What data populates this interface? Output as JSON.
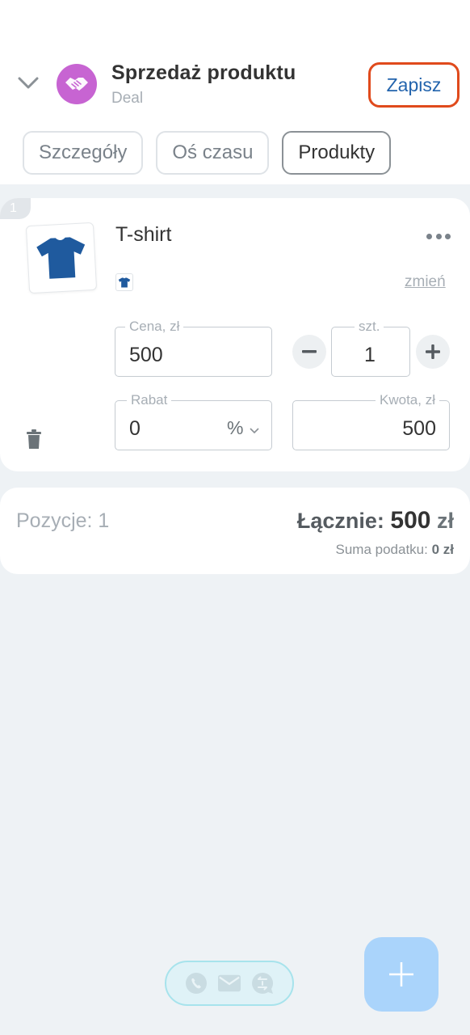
{
  "header": {
    "title": "Sprzedaż produktu",
    "subtitle": "Deal",
    "save_label": "Zapisz",
    "avatar_color": "#c764d2",
    "avatar_icon": "handshake-icon"
  },
  "tabs": [
    {
      "label": "Szczegóły",
      "active": false
    },
    {
      "label": "Oś czasu",
      "active": false
    },
    {
      "label": "Produkty",
      "active": true
    }
  ],
  "product": {
    "index": "1",
    "name": "T-shirt",
    "image_icon": "tshirt-icon",
    "change_label": "zmień",
    "price_label": "Cena, zł",
    "price_value": "500",
    "qty_label": "szt.",
    "qty_value": "1",
    "discount_label": "Rabat",
    "discount_value": "0",
    "discount_unit": "%",
    "amount_label": "Kwota, zł",
    "amount_value": "500"
  },
  "summary": {
    "positions_text": "Pozycje: 1",
    "total_label": "Łącznie:",
    "total_amount": "500",
    "total_currency": "zł",
    "tax_label": "Suma podatku:",
    "tax_value": "0 zł"
  },
  "bottom_bar": {
    "icons": [
      "phone-icon",
      "mail-icon",
      "chat-icon"
    ],
    "fab_icon": "plus-icon"
  },
  "colors": {
    "accent_link": "#2364ad",
    "highlight_border": "#e04a1c",
    "product_blue": "#1f5a9e",
    "fab": "#aad4fb"
  }
}
